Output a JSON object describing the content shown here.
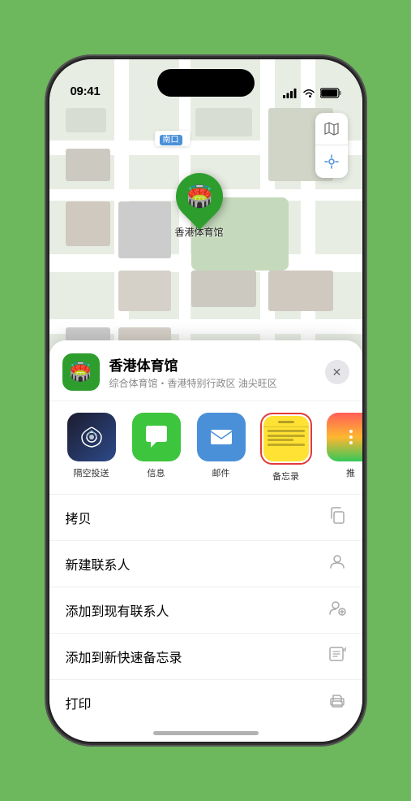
{
  "phone": {
    "status_bar": {
      "time": "09:41",
      "signal_bars": "▌▌▌",
      "wifi": "wifi",
      "battery": "battery"
    }
  },
  "map": {
    "location_label": "南口",
    "pin_label": "香港体育馆"
  },
  "sheet": {
    "venue_name": "香港体育馆",
    "venue_sub": "综合体育馆・香港特别行政区 油尖旺区",
    "close_label": "✕",
    "share_items": [
      {
        "id": "airdrop",
        "label": "隔空投送",
        "icon": "📶"
      },
      {
        "id": "messages",
        "label": "信息",
        "icon": "💬"
      },
      {
        "id": "mail",
        "label": "邮件",
        "icon": "✉️"
      },
      {
        "id": "notes",
        "label": "备忘录",
        "icon": "notes"
      },
      {
        "id": "more",
        "label": "推",
        "icon": "dots"
      }
    ],
    "actions": [
      {
        "label": "拷贝",
        "icon": "copy"
      },
      {
        "label": "新建联系人",
        "icon": "person"
      },
      {
        "label": "添加到现有联系人",
        "icon": "person-add"
      },
      {
        "label": "添加到新快速备忘录",
        "icon": "memo"
      },
      {
        "label": "打印",
        "icon": "print"
      }
    ]
  }
}
